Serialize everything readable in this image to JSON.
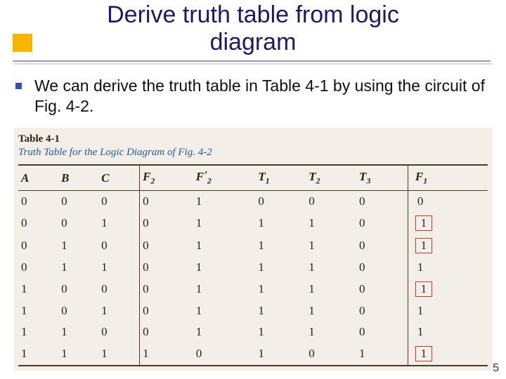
{
  "slide": {
    "title_line1": "Derive truth table from logic",
    "title_line2": "diagram",
    "bullet": "We can derive the truth table in Table 4-1 by using the circuit of Fig. 4-2.",
    "page_number": "5"
  },
  "table": {
    "label": "Table 4-1",
    "caption": "Truth Table for the Logic Diagram of Fig. 4-2",
    "headers": [
      "A",
      "B",
      "C",
      "F2",
      "F'2",
      "T1",
      "T2",
      "T3",
      "F1"
    ]
  },
  "chart_data": {
    "type": "table",
    "title": "Truth Table for the Logic Diagram of Fig. 4-2",
    "columns": [
      "A",
      "B",
      "C",
      "F2",
      "F2_prime",
      "T1",
      "T2",
      "T3",
      "F1"
    ],
    "rows": [
      {
        "A": 0,
        "B": 0,
        "C": 0,
        "F2": 0,
        "F2_prime": 1,
        "T1": 0,
        "T2": 0,
        "T3": 0,
        "F1": 0,
        "F1_boxed": false
      },
      {
        "A": 0,
        "B": 0,
        "C": 1,
        "F2": 0,
        "F2_prime": 1,
        "T1": 1,
        "T2": 1,
        "T3": 0,
        "F1": 1,
        "F1_boxed": true
      },
      {
        "A": 0,
        "B": 1,
        "C": 0,
        "F2": 0,
        "F2_prime": 1,
        "T1": 1,
        "T2": 1,
        "T3": 0,
        "F1": 1,
        "F1_boxed": true
      },
      {
        "A": 0,
        "B": 1,
        "C": 1,
        "F2": 0,
        "F2_prime": 1,
        "T1": 1,
        "T2": 1,
        "T3": 0,
        "F1": 1,
        "F1_boxed": false
      },
      {
        "A": 1,
        "B": 0,
        "C": 0,
        "F2": 0,
        "F2_prime": 1,
        "T1": 1,
        "T2": 1,
        "T3": 0,
        "F1": 1,
        "F1_boxed": true
      },
      {
        "A": 1,
        "B": 0,
        "C": 1,
        "F2": 0,
        "F2_prime": 1,
        "T1": 1,
        "T2": 1,
        "T3": 0,
        "F1": 1,
        "F1_boxed": false
      },
      {
        "A": 1,
        "B": 1,
        "C": 0,
        "F2": 0,
        "F2_prime": 1,
        "T1": 1,
        "T2": 1,
        "T3": 0,
        "F1": 1,
        "F1_boxed": false
      },
      {
        "A": 1,
        "B": 1,
        "C": 1,
        "F2": 1,
        "F2_prime": 0,
        "T1": 1,
        "T2": 0,
        "T3": 1,
        "F1": 1,
        "F1_boxed": true
      }
    ]
  }
}
